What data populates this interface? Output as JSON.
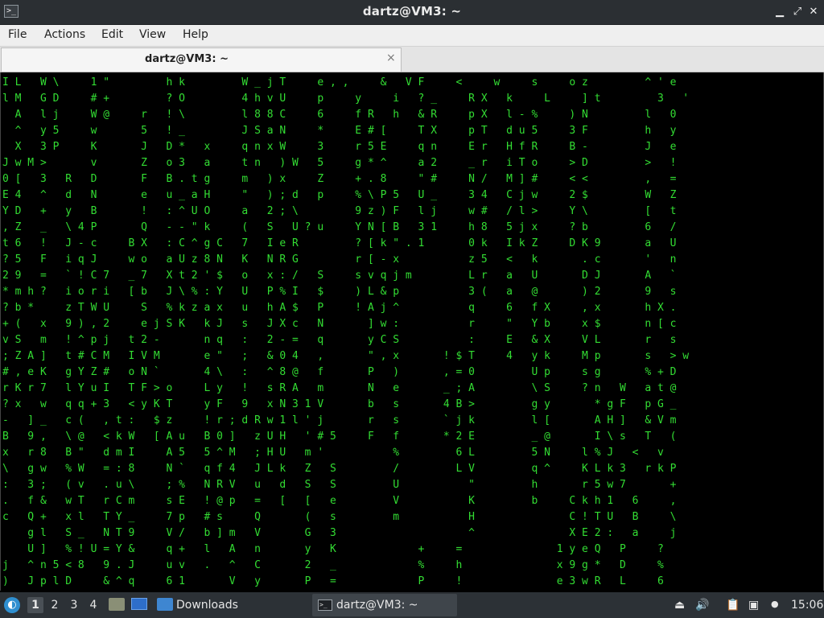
{
  "window": {
    "title": "dartz@VM3: ~",
    "app_icon": "terminal-icon",
    "controls": [
      "minimize-icon",
      "maximize-icon",
      "close-icon"
    ]
  },
  "menu": [
    "File",
    "Actions",
    "Edit",
    "View",
    "Help"
  ],
  "tab": {
    "label": "dartz@VM3: ~",
    "close": "×"
  },
  "terminal": {
    "foreground": "#33dd33",
    "background": "#000000",
    "lines": [
      "I L   W \\     1 \"         h k         W _ j T     e , ,     &   V F     <     w     s     o z         ^ ' e",
      "l M   G D     # +         ? O         4 h v U     p     y     i   ? _     R X   k     L     ] t         3   '",
      "  A   l j     W @     r   ! \\         l 8 8 C     6     f R   h   & R     p X   l - %     ) N         l   0",
      "  ^   y 5     w       5   ! _         J S a N     *     E # [     T X     p T   d u 5     3 F         h   y",
      "  X   3 P     K       J   D *   x     q n x W     3     r 5 E     q n     E r   H f R     B -         J   e",
      "J w M >       v       Z   o 3   a     t n   ) W   5     g * ^     a 2     _ r   i T o     > D         >   !",
      "0 [   3   R   D       F   B . t g     m   ) x     Z     + . 8     \" #     N /   M ] #     < <         ,   =",
      "E 4   ^   d   N       e   u _ a H     \"   ) ; d   p     % \\ P 5   U _     3 4   C j w     2 $         W   Z",
      "Y D   +   y   B       !   : ^ U O     a   2 ; \\         9 z ) F   l j     w #   / l >     Y \\         [   t",
      ", Z   _   \\ 4 P       Q   - - \" k     (   S   U ? u     Y N [ B   3 1     h 8   5 j x     ? b         6   /",
      "t 6   !   J - c     B X   : C ^ g C   7   I e R         ? [ k \" . 1       0 k   I k Z     D K 9       a   U",
      "? 5   F   i q J     w o   a U z 8 N   K   N R G         r [ - x           z 5   <   k       . c       '   n",
      "2 9   =   ` ! C 7   _ 7   X t 2 ' $   o   x : /   S     s v q j m         L r   a   U       D J       A   `",
      "* m h ?   i o r i   [ b   J \\ % : Y   U   P % I   $     ) L & p           3 (   a   @       ) 2       9   s",
      "? b *     z T W U     S   % k z a x   u   h A $   P     ! A j ^           q     6   f X     , x       h X .",
      "+ (   x   9 ) , 2     e j S K   k J   s   J X c   N       ] w :           r     \"   Y b     x $       n [ c",
      "v S   m   ! ^ p j   t 2 -       n q   :   2 - =   q       y C S           :     E   & X     V L       r   s",
      "; Z A ]   t # C M   I V M       e \"   ;   & 0 4   ,       \" , x       ! $ T     4   y k     M p       s   > w",
      "# , e K   g Y Z #   o N `       4 \\   :   ^ 8 @   f       P   )       , = 0         U p     s g       % + D",
      "r K r 7   l Y u I   T F > o     L y   !   s R A   m       N   e       _ ; A         \\ S     ? n   W   a t @",
      "? x   w   q q + 3   < y K T     y F   9   x N 3 1 V       b   s       4 B >         g y       * g F   p G _",
      "-   ] _   c (   , t :   $ z     ! r ; d R w 1 l ' j       r   s       ` j k         l [       A H ]   & V m",
      "B   9 ,   \\ @   < k W   [ A u   B 0 ]   z U H   ' # 5     F   f       * 2 E         _ @       I \\ s   T   (",
      "x   r 8   B \"   d m I     A 5   5 ^ M   ; H U   m '           %         6 L         5 N     l % J   <   v",
      "\\   g w   % W   = : 8     N `   q f 4   J L k   Z   S         /         L V         q ^     K L k 3   r k P",
      ":   3 ;   ( v   . u \\     ; %   N R V   u   d   S   S         U           \"         h       r 5 w 7       +",
      ".   f &   w T   r C m     s E   ! @ p   =   [   [   e         V           K         b     C k h 1   6     ,",
      "c   Q +   x l   T Y _     7 p   # s     Q       (   s         m           H               C ! T U   B     \\",
      "    g l   S _   N T 9     V /   b ] m   V       G   3                     ^               X E 2 :   a     j",
      "    U ]   % ! U = Y &     q +   l   A   n       y   K             +     =               1 y e Q   P     ?",
      "j   ^ n 5 < 8   9 . J     u v   .   ^   C       2   _             %     h               x 9 g *   D     %",
      ")   J p l D     & ^ q     6 1       V   y       P   =             P     !               e 3 w R   L     6"
    ]
  },
  "taskbar": {
    "start_icon": "lxqt-menu-icon",
    "workspaces": [
      "1",
      "2",
      "3",
      "4"
    ],
    "active_workspace": "1",
    "quicklaunch": [
      "file-manager-icon",
      "show-desktop-icon"
    ],
    "folder_label": "Downloads",
    "task_label": "dartz@VM3: ~",
    "tray_icons": [
      "eject-icon",
      "volume-icon",
      "clipboard-icon",
      "network-icon"
    ],
    "clock": "15:06"
  }
}
